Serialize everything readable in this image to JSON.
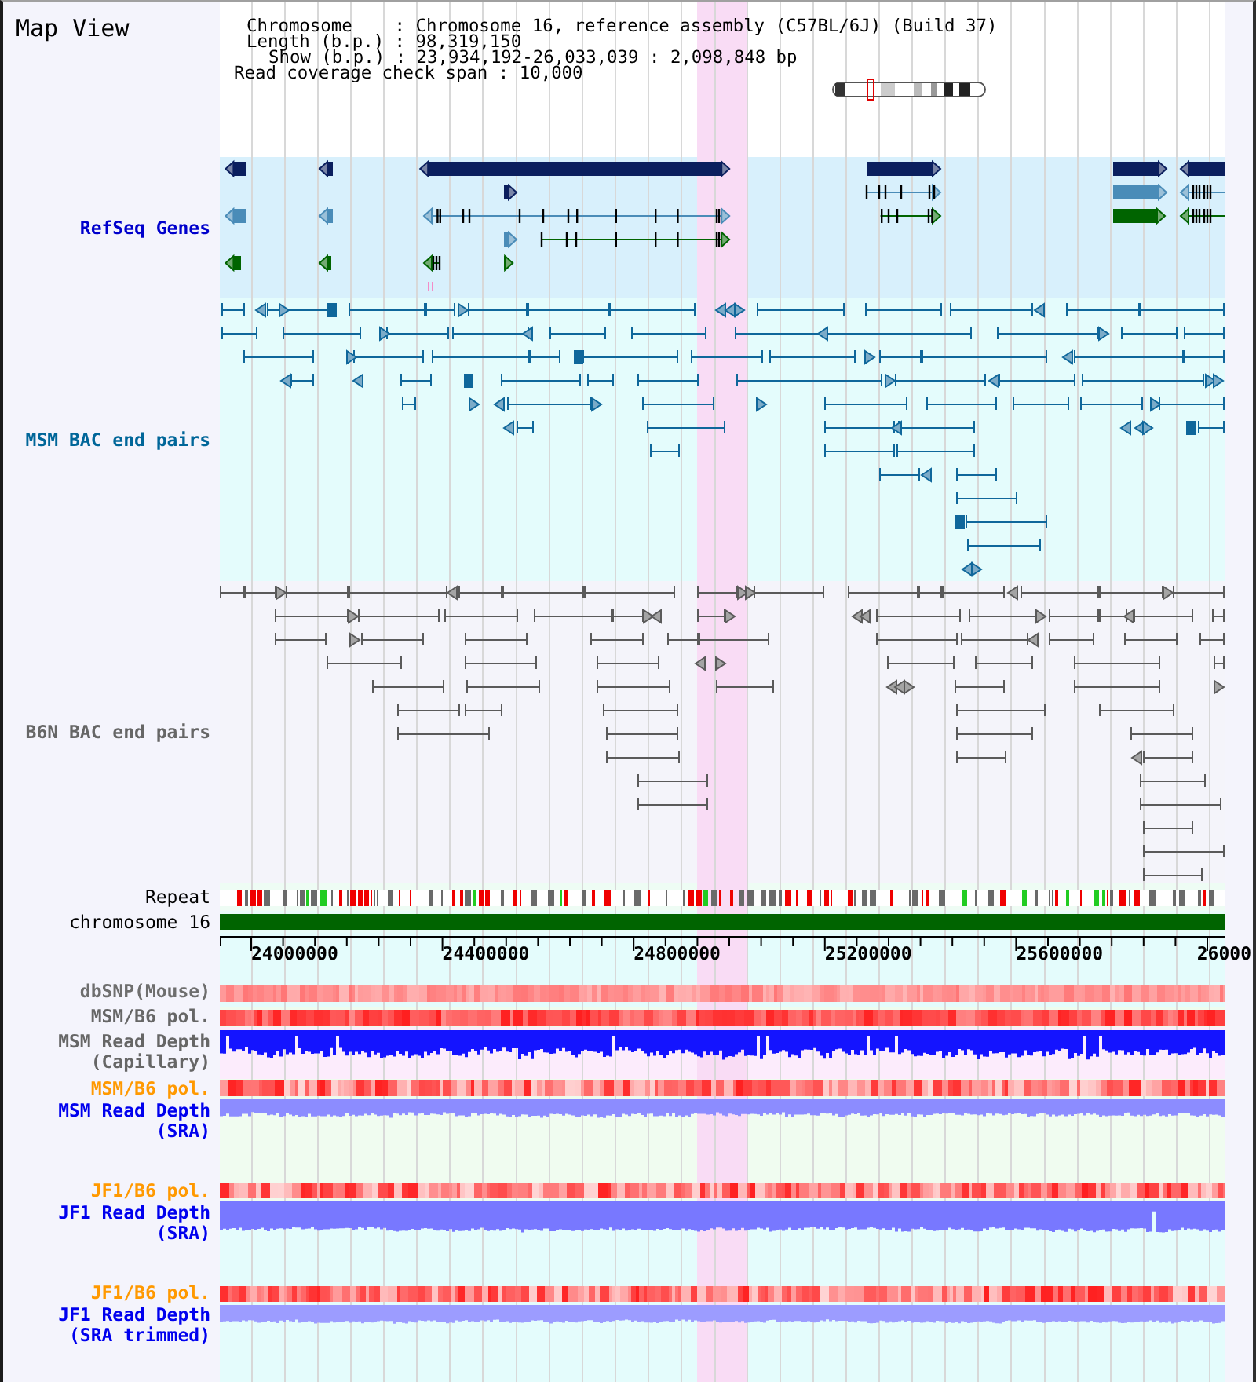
{
  "title": "Map View",
  "header": {
    "lines": [
      "Chromosome    : Chromosome 16, reference assembly (C57BL/6J) (Build 37)",
      "Length (b.p.) : 98,319,150",
      "Show (b.p.) : 23,934,192-26,033,039 : 2,098,848 bp",
      "Read coverage check span : 10,000"
    ]
  },
  "tracks": [
    {
      "kind": "genes",
      "label": "RefSeq Genes",
      "color": "#0000cc"
    },
    {
      "kind": "bac_pairs",
      "label": "MSM BAC end pairs",
      "color": "#006699"
    },
    {
      "kind": "bac_pairs",
      "label": "B6N BAC end pairs",
      "color": "#666666"
    },
    {
      "kind": "repeat",
      "label": "Repeat",
      "color": "#000000"
    },
    {
      "kind": "chromosome",
      "label": "chromosome 16",
      "color": "#000000"
    },
    {
      "kind": "axis",
      "ticks": [
        "24000000",
        "24400000",
        "24800000",
        "25200000",
        "25600000",
        "26000"
      ]
    },
    {
      "kind": "heatmap",
      "label": "dbSNP(Mouse)",
      "color": "#6e6e6e"
    },
    {
      "kind": "heatmap",
      "label": "MSM/B6 pol.",
      "color": "#666666"
    },
    {
      "kind": "depth",
      "label": "MSM Read Depth (Capillary)",
      "color": "#666666"
    },
    {
      "kind": "heatmap",
      "label": "MSM/B6 pol.",
      "color": "#ff9900"
    },
    {
      "kind": "depth",
      "label": "MSM Read Depth (SRA)",
      "color": "#0000ee"
    },
    {
      "kind": "heatmap",
      "label": "JF1/B6 pol.",
      "color": "#ff9900"
    },
    {
      "kind": "depth",
      "label": "JF1 Read Depth (SRA)",
      "color": "#0000ee"
    },
    {
      "kind": "heatmap",
      "label": "JF1/B6 pol.",
      "color": "#ff9900"
    },
    {
      "kind": "depth",
      "label": "JF1 Read Depth (SRA trimmed)",
      "color": "#0000ee"
    }
  ]
}
